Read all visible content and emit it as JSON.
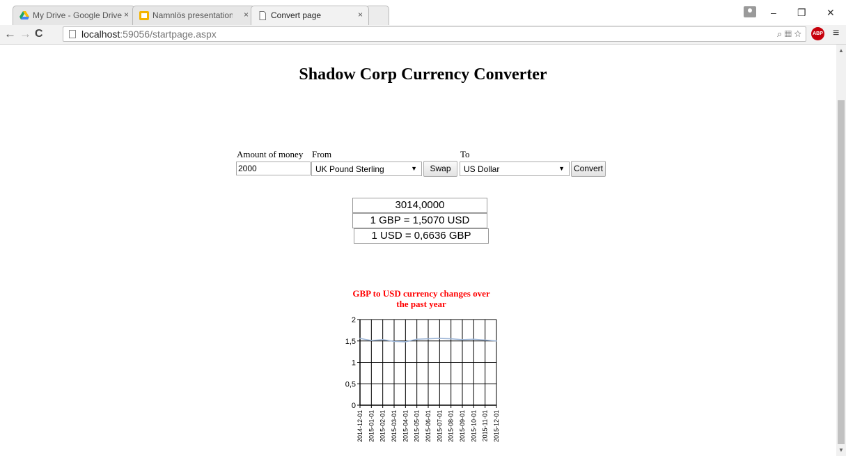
{
  "browser": {
    "tabs": [
      {
        "title": "My Drive - Google Drive",
        "close": "×"
      },
      {
        "title": "Namnlös presentation - G",
        "close": "×"
      },
      {
        "title": "Convert page",
        "close": "×"
      }
    ],
    "url_host": "localhost",
    "url_rest": ":59056/startpage.aspx",
    "window_controls": {
      "minimize": "–",
      "restore": "❐",
      "close": "✕"
    },
    "abp_label": "ABP"
  },
  "page": {
    "title": "Shadow Corp Currency Converter",
    "form": {
      "amount_label": "Amount of money",
      "amount_value": "2000",
      "from_label": "From",
      "from_value": "UK Pound Sterling",
      "swap_label": "Swap",
      "to_label": "To",
      "to_value": "US Dollar",
      "convert_label": "Convert"
    },
    "results": {
      "converted": "3014,0000",
      "rate_forward": "1 GBP = 1,5070 USD",
      "rate_reverse": "1 USD = 0,6636 GBP"
    }
  },
  "chart_data": {
    "type": "line",
    "title": "GBP to USD currency changes over the past year",
    "title_lines": [
      "GBP to USD currency changes over",
      "the past year"
    ],
    "x": [
      "2014-12-01",
      "2015-01-01",
      "2015-02-01",
      "2015-03-01",
      "2015-04-01",
      "2015-05-01",
      "2015-06-01",
      "2015-07-01",
      "2015-08-01",
      "2015-09-01",
      "2015-10-01",
      "2015-11-01",
      "2015-12-01"
    ],
    "series": [
      {
        "values": [
          1.56,
          1.51,
          1.53,
          1.49,
          1.48,
          1.54,
          1.55,
          1.56,
          1.55,
          1.53,
          1.54,
          1.52,
          1.5
        ]
      }
    ],
    "ylim": [
      0,
      2
    ],
    "yticks": [
      "0",
      "0,5",
      "1",
      "1,5",
      "2"
    ],
    "ytick_values": [
      0,
      0.5,
      1,
      1.5,
      2
    ],
    "grid": true,
    "line_color": "#9ab3d5",
    "title_color": "#ff0000"
  }
}
